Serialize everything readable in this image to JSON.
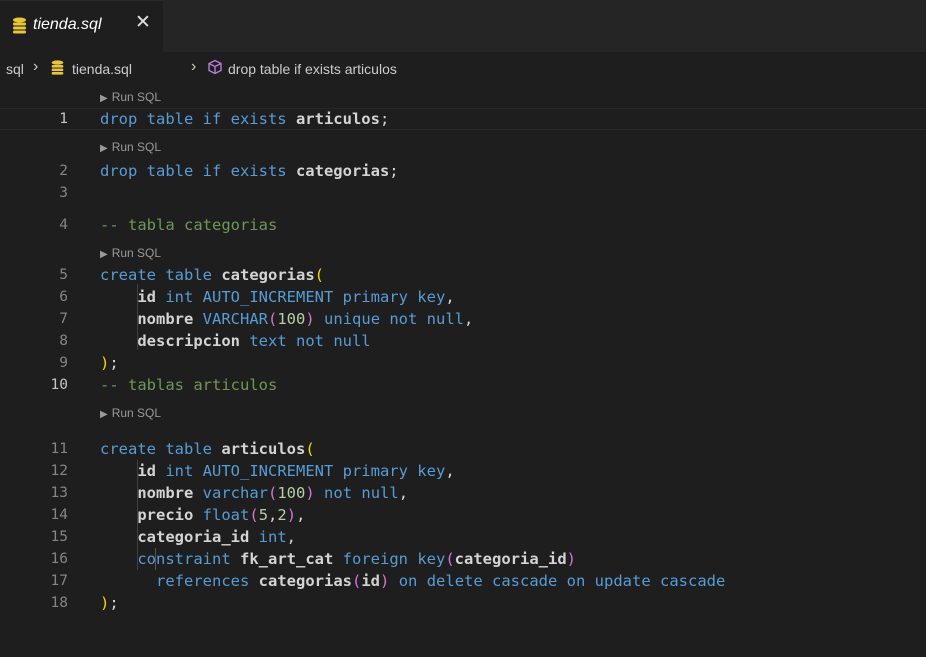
{
  "tab": {
    "filename": "tienda.sql",
    "close_glyph": "✕"
  },
  "breadcrumb": {
    "folder": "sql",
    "file": "tienda.sql",
    "symbol": "drop table if exists articulos",
    "separator": "›"
  },
  "codelens": {
    "run_label": "Run SQL"
  },
  "lines": [
    {
      "n": "1",
      "text": "drop table if exists articulos;"
    },
    {
      "n": "2",
      "text": "drop table if exists categorias;"
    },
    {
      "n": "3",
      "text": ""
    },
    {
      "n": "4",
      "text": "-- tabla categorias"
    },
    {
      "n": "5",
      "text": "create table categorias("
    },
    {
      "n": "6",
      "text": "id int AUTO_INCREMENT primary key,"
    },
    {
      "n": "7",
      "text": "nombre VARCHAR(100) unique not null,"
    },
    {
      "n": "8",
      "text": "descripcion text not null"
    },
    {
      "n": "9",
      "text": ");"
    },
    {
      "n": "10",
      "text": "-- tablas articulos"
    },
    {
      "n": "11",
      "text": "create table articulos("
    },
    {
      "n": "12",
      "text": "id int AUTO_INCREMENT primary key,"
    },
    {
      "n": "13",
      "text": "nombre varchar(100) not null,"
    },
    {
      "n": "14",
      "text": "precio float(5,2),"
    },
    {
      "n": "15",
      "text": "categoria_id int,"
    },
    {
      "n": "16",
      "text": "constraint fk_art_cat foreign key(categoria_id)"
    },
    {
      "n": "17",
      "text": "references categorias(id) on delete cascade on update cascade"
    },
    {
      "n": "18",
      "text": ");"
    }
  ],
  "colors": {
    "background": "#1e1e1e",
    "keyword": "#569cd6",
    "comment": "#6a9955",
    "number": "#b5cea8",
    "bracket": "#ffd700",
    "bracket_nested": "#da70d6",
    "db_icon": "#e8c53a"
  }
}
